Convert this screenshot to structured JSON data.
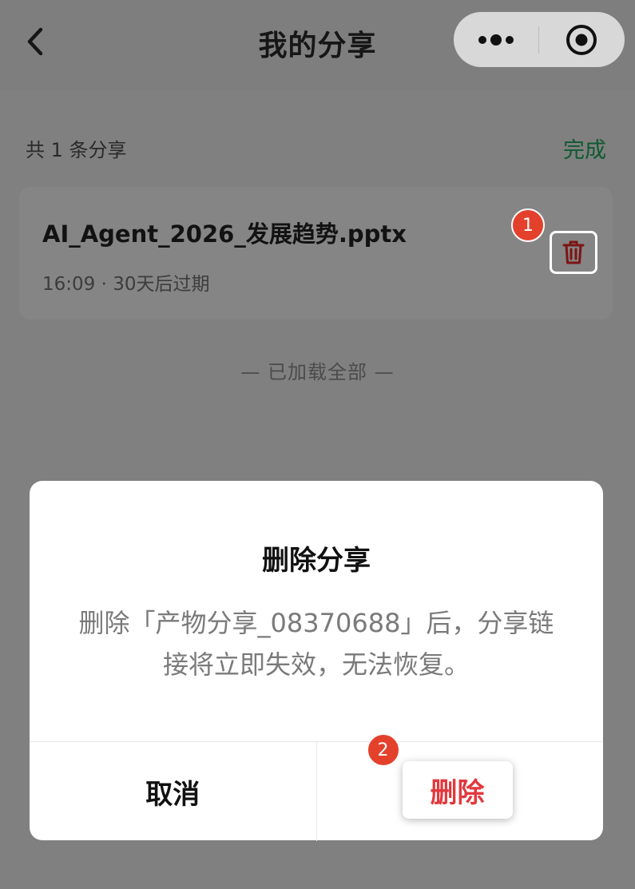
{
  "nav": {
    "title": "我的分享",
    "back_icon": "chevron-left-icon",
    "more_icon": "more-dots-icon",
    "close_icon": "target-close-icon"
  },
  "list": {
    "count_text": "共 1 条分享",
    "done_label": "完成",
    "items": [
      {
        "file_name": "AI_Agent_2026_发展趋势.pptx",
        "meta": "16:09 · 30天后过期",
        "delete_icon": "trash-icon"
      }
    ],
    "footer_text": "— 已加载全部 —"
  },
  "annotations": {
    "step1": "1",
    "step2": "2"
  },
  "dialog": {
    "title": "删除分享",
    "message": "删除「产物分享_08370688」后，分享链接将立即失效，无法恢复。",
    "cancel_label": "取消",
    "delete_label": "删除"
  },
  "colors": {
    "overlay": "#808080",
    "done": "#0f5a31",
    "danger": "#e2383d",
    "trash": "#7d1414",
    "badge": "#e4412c"
  }
}
